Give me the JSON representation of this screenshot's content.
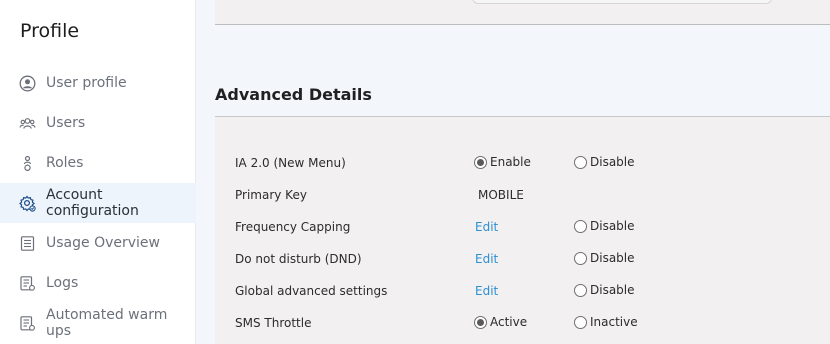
{
  "sidebar": {
    "title": "Profile",
    "items": [
      {
        "label": "User profile",
        "icon": "user-circle-icon",
        "active": false
      },
      {
        "label": "Users",
        "icon": "users-icon",
        "active": false
      },
      {
        "label": "Roles",
        "icon": "roles-icon",
        "active": false
      },
      {
        "label": "Account configuration",
        "icon": "gear-icon",
        "active": true
      },
      {
        "label": "Usage Overview",
        "icon": "usage-icon",
        "active": false
      },
      {
        "label": "Logs",
        "icon": "logs-icon",
        "active": false
      },
      {
        "label": "Automated warm ups",
        "icon": "warmup-icon",
        "active": false
      }
    ]
  },
  "main": {
    "section_title": "Advanced Details",
    "rows": [
      {
        "label": "IA 2.0 (New Menu)",
        "option1": "Enable",
        "option1_checked": true,
        "option2": "Disable",
        "option2_checked": false
      },
      {
        "label": "Primary Key",
        "value": "MOBILE"
      },
      {
        "label": "Frequency Capping",
        "edit": "Edit",
        "option2": "Disable",
        "option2_checked": false
      },
      {
        "label": "Do not disturb (DND)",
        "edit": "Edit",
        "option2": "Disable",
        "option2_checked": false
      },
      {
        "label": "Global advanced settings",
        "edit": "Edit",
        "option2": "Disable",
        "option2_checked": false
      },
      {
        "label": "SMS Throttle",
        "option1": "Active",
        "option1_checked": true,
        "option2": "Inactive",
        "option2_checked": false
      }
    ]
  },
  "colors": {
    "accent": "#2f8fd1",
    "sidebar_active": "#eef4fb",
    "panel_bg": "#f2f0f0",
    "page_bg": "#f3f7fc"
  }
}
